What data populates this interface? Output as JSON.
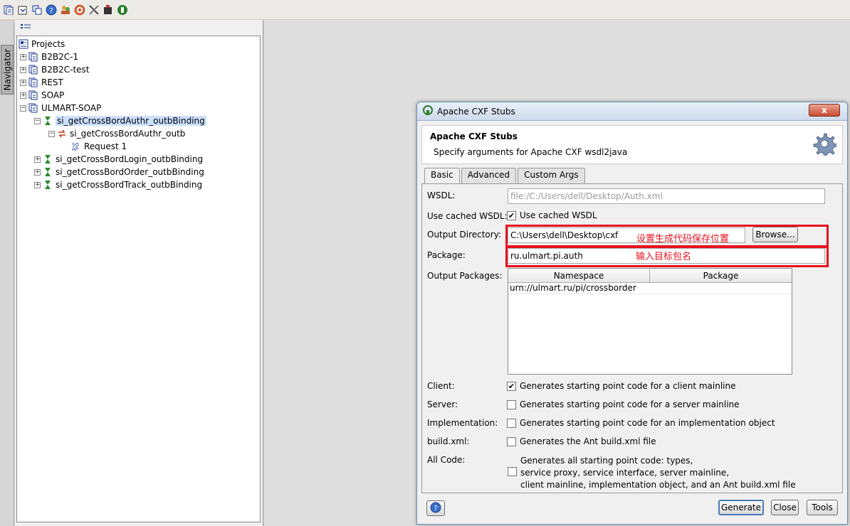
{
  "toolbar": {
    "icons": [
      "new-project-icon",
      "import-icon",
      "preferences-icon",
      "help-icon",
      "community-icon",
      "refresh-icon",
      "tools-icon",
      "plugin-icon",
      "soapui-icon"
    ]
  },
  "navigator": {
    "tab_label": "Navigator",
    "tree": {
      "root": "Projects",
      "items": [
        {
          "label": "B2B2C-1"
        },
        {
          "label": "B2B2C-test"
        },
        {
          "label": "REST"
        },
        {
          "label": "SOAP"
        },
        {
          "label": "ULMART-SOAP"
        },
        {
          "label": "si_getCrossBordAuthr_outbBinding"
        },
        {
          "label": "si_getCrossBordAuthr_outb"
        },
        {
          "label": "Request 1"
        },
        {
          "label": "si_getCrossBordLogin_outbBinding"
        },
        {
          "label": "si_getCrossBordOrder_outbBinding"
        },
        {
          "label": "si_getCrossBordTrack_outbBinding"
        }
      ]
    }
  },
  "dialog": {
    "title": "Apache CXF Stubs",
    "close_label": "x",
    "header_title": "Apache CXF Stubs",
    "header_subtitle": "Specify arguments for Apache CXF wsdl2java",
    "tabs": [
      {
        "label": "Basic"
      },
      {
        "label": "Advanced"
      },
      {
        "label": "Custom Args"
      }
    ],
    "wsdl_label": "WSDL:",
    "wsdl_value": "file:/C:/Users/dell/Desktop/Auth.xml",
    "cached_label": "Use cached WSDL:",
    "cached_text": "Use cached WSDL",
    "output_dir_label": "Output Directory:",
    "output_dir_value": "C:\\Users\\dell\\Desktop\\cxf",
    "output_dir_note": "设置生成代码保存位置",
    "browse_label": "Browse...",
    "package_label": "Package:",
    "package_value": "ru.ulmart.pi.auth",
    "package_note": "输入目标包名",
    "output_packages_label": "Output Packages:",
    "output_packages_columns": [
      "Namespace",
      "Package"
    ],
    "output_packages_rows": [
      [
        "urn://ulmart.ru/pi/crossborder",
        ""
      ]
    ],
    "client_label": "Client:",
    "client_text": "Generates starting point code for a client mainline",
    "server_label": "Server:",
    "server_text": "Generates starting point code for a server mainline",
    "impl_label": "Implementation:",
    "impl_text": "Generates starting point code for an implementation object",
    "build_label": "build.xml:",
    "build_text": "Generates the Ant build.xml file",
    "allcode_label": "All Code:",
    "allcode_line1": "Generates all starting point code: types,",
    "allcode_line2": "service proxy, service interface, server mainline,",
    "allcode_line3": "client mainline, implementation object, and an Ant build.xml file",
    "buttons": {
      "generate": "Generate",
      "close": "Close",
      "tools": "Tools"
    }
  }
}
